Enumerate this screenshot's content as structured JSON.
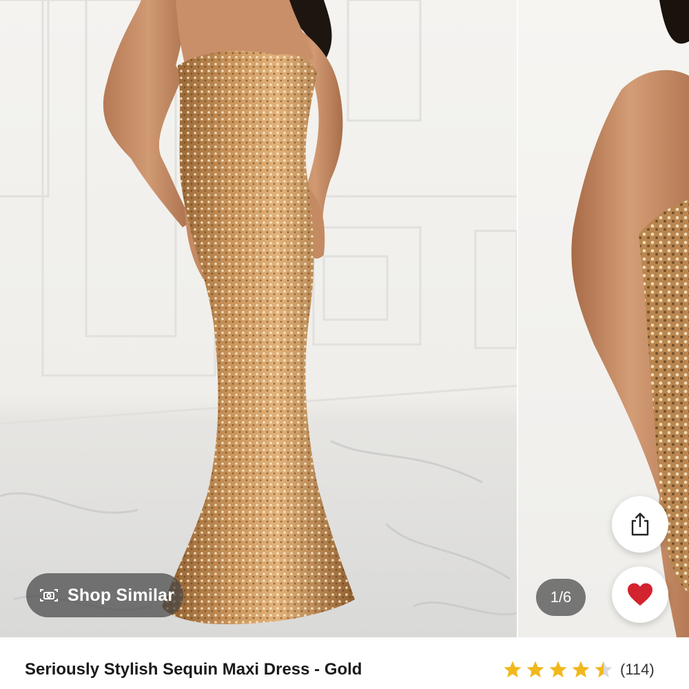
{
  "gallery": {
    "shop_similar_label": "Shop Similar",
    "page_counter": "1/6",
    "share_icon": "share-icon",
    "favorite_icon": "heart-icon",
    "favorite_color": "#d3232f"
  },
  "product": {
    "title": "Seriously Stylish Sequin Maxi Dress - Gold",
    "rating": 4.5,
    "review_count": "(114)",
    "star_color": "#f0b81c"
  }
}
